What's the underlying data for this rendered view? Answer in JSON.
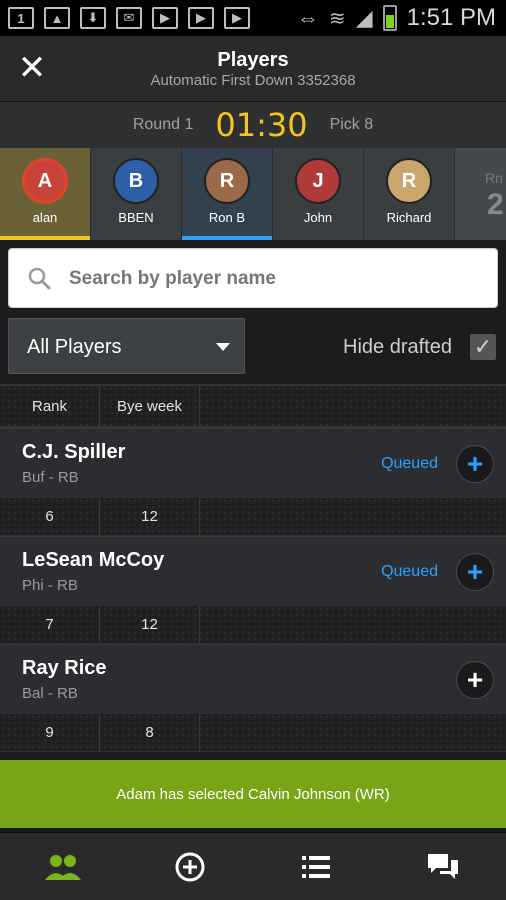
{
  "status_bar": {
    "time": "1:51 PM",
    "notification_badge": "1"
  },
  "header": {
    "title": "Players",
    "subtitle": "Automatic First Down 3352368",
    "close_glyph": "✕"
  },
  "round_bar": {
    "round_label": "Round 1",
    "timer": "01:30",
    "pick_label": "Pick 8"
  },
  "drafters": [
    {
      "name": "alan",
      "initial": "A",
      "state": "active"
    },
    {
      "name": "BBEN",
      "initial": "B",
      "state": ""
    },
    {
      "name": "Ron B",
      "initial": "R",
      "state": "mine"
    },
    {
      "name": "John",
      "initial": "J",
      "state": ""
    },
    {
      "name": "Richard",
      "initial": "R",
      "state": ""
    }
  ],
  "next_round": {
    "label": "Rn",
    "number": "2"
  },
  "search": {
    "placeholder": "Search by player name"
  },
  "filter": {
    "selected": "All Players",
    "hide_drafted_label": "Hide drafted",
    "hide_drafted_checked": true
  },
  "columns": {
    "rank": "Rank",
    "bye_week": "Bye week"
  },
  "players": [
    {
      "name": "C.J. Spiller",
      "team_pos": "Buf - RB",
      "status": "Queued",
      "rank": "6",
      "bye": "12"
    },
    {
      "name": "LeSean McCoy",
      "team_pos": "Phi - RB",
      "status": "Queued",
      "rank": "7",
      "bye": "12"
    },
    {
      "name": "Ray Rice",
      "team_pos": "Bal - RB",
      "status": "",
      "rank": "9",
      "bye": "8"
    }
  ],
  "toast": {
    "message": "Adam has selected Calvin Johnson (WR)"
  },
  "bottom_nav": {
    "active_color": "#7ab520",
    "icons": [
      "players-icon",
      "add-icon",
      "list-icon",
      "chat-icon"
    ]
  },
  "colors": {
    "accent_yellow": "#f5c518",
    "accent_blue": "#2aa1ff",
    "toast_green": "#7aa418"
  }
}
